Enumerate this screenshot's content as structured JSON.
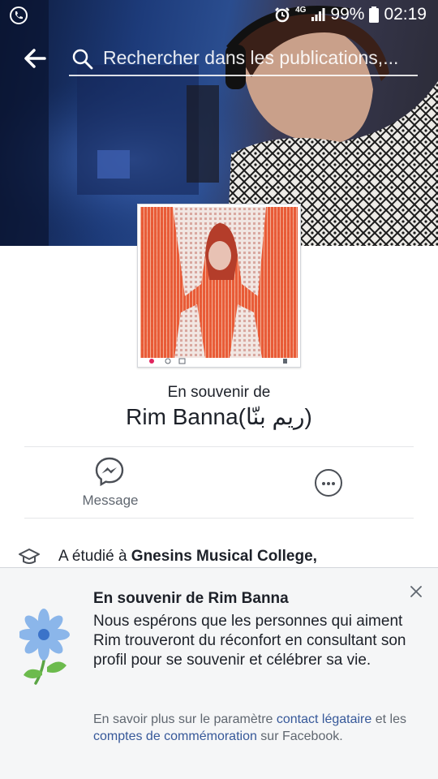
{
  "status_bar": {
    "network": "4G",
    "battery": "99%",
    "time": "02:19"
  },
  "header": {
    "search_placeholder": "Rechercher dans les publications,..."
  },
  "profile": {
    "memorial_label": "En souvenir de",
    "name": "Rim Banna(ريم بنّا)"
  },
  "actions": {
    "message_label": "Message"
  },
  "about": {
    "education_prefix": "A étudié à ",
    "education_school": "Gnesins Musical College,"
  },
  "memorial_sheet": {
    "title": "En souvenir de Rim Banna",
    "body": "Nous espérons que les personnes qui aiment Rim trouveront du réconfort en consultant son profil pour se souvenir et célébrer sa vie.",
    "footer": {
      "t1": "En savoir plus sur le paramètre ",
      "link1": "contact légataire",
      "t2": " et les ",
      "link2": "comptes de commémoration",
      "t3": " sur Facebook."
    }
  },
  "colors": {
    "link": "#365899",
    "sheet_bg": "#f5f6f7",
    "text": "#1d2129",
    "muted": "#606770"
  }
}
